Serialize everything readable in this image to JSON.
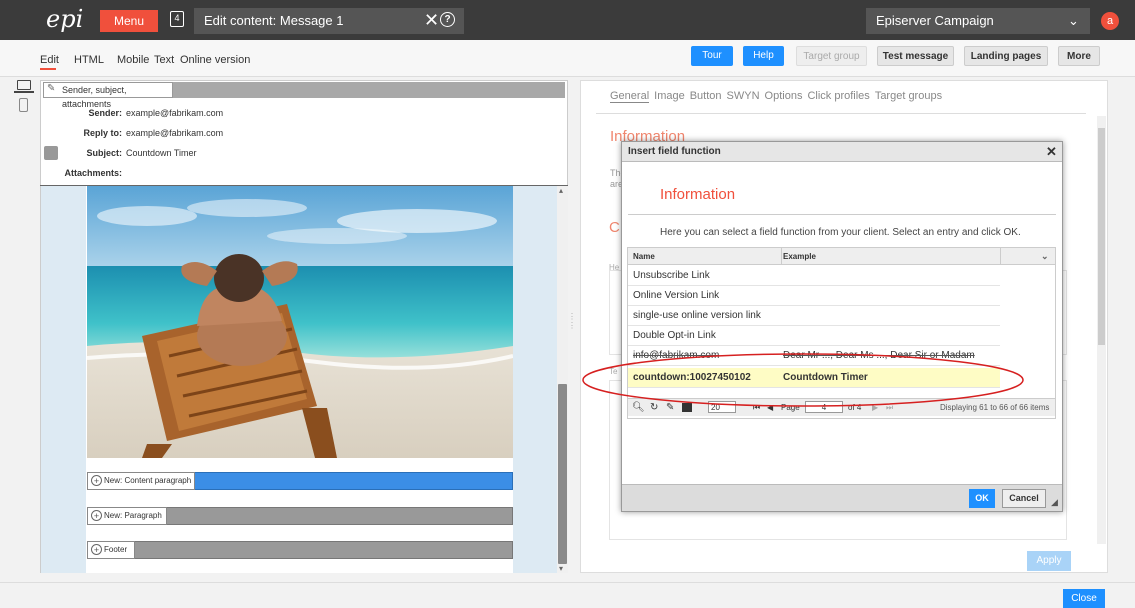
{
  "topbar": {
    "logo": "epi",
    "menu_label": "Menu",
    "doc_icon_num": "4",
    "title": "Edit content: Message 1",
    "close": "✕",
    "help": "?",
    "campaign": "Episerver Campaign",
    "avatar": "a"
  },
  "nav": [
    "Edit",
    "HTML",
    "Mobile",
    "Text",
    "Online version"
  ],
  "buttons": {
    "tour": "Tour",
    "help": "Help",
    "target_group": "Target group",
    "test_message": "Test message",
    "landing_pages": "Landing pages",
    "more": "More"
  },
  "editor": {
    "section_label": "Sender, subject, attachments",
    "sender_label": "Sender:",
    "sender": "example@fabrikam.com",
    "reply_label": "Reply to:",
    "reply_to": "example@fabrikam.com",
    "subject_label": "Subject:",
    "subject": "Countdown Timer",
    "attachments_label": "Attachments:",
    "new_content_paragraph": "New: Content paragraph",
    "new_paragraph": "New: Paragraph",
    "footer": "Footer"
  },
  "right": {
    "tabs": [
      "General",
      "Image",
      "Button",
      "SWYN",
      "Options",
      "Click profiles",
      "Target groups"
    ],
    "bg_title": "Information",
    "bg_text_1": "The",
    "bg_text_2": "are",
    "bg_c": "C",
    "bg_he": "He",
    "bg_te": "Te",
    "apply": "Apply"
  },
  "dialog": {
    "title": "Insert field function",
    "heading": "Information",
    "description": "Here you can select a field function from your client. Select an entry and click OK.",
    "col_name": "Name",
    "col_example": "Example",
    "rows": [
      {
        "name": "Unsubscribe Link",
        "example": ""
      },
      {
        "name": "Online Version Link",
        "example": ""
      },
      {
        "name": "single-use online version link",
        "example": ""
      },
      {
        "name": "Double Opt-in Link",
        "example": ""
      },
      {
        "name": "info@fabrikam.com",
        "example": "Dear Mr ..., Dear Ms ..., Dear Sir or Madam"
      },
      {
        "name": "countdown:10027450102",
        "example": "Countdown Timer"
      }
    ],
    "pager": {
      "page_size": "20",
      "page_label": "Page",
      "page": "4",
      "of": "of 4",
      "displaying": "Displaying 61 to 66 of 66 items"
    },
    "ok": "OK",
    "cancel": "Cancel"
  },
  "close_label": "Close",
  "colors": {
    "accent": "#f0503c",
    "primary": "#1e90ff",
    "selected_row": "#fefcc5",
    "highlight_ellipse": "#d62020"
  }
}
